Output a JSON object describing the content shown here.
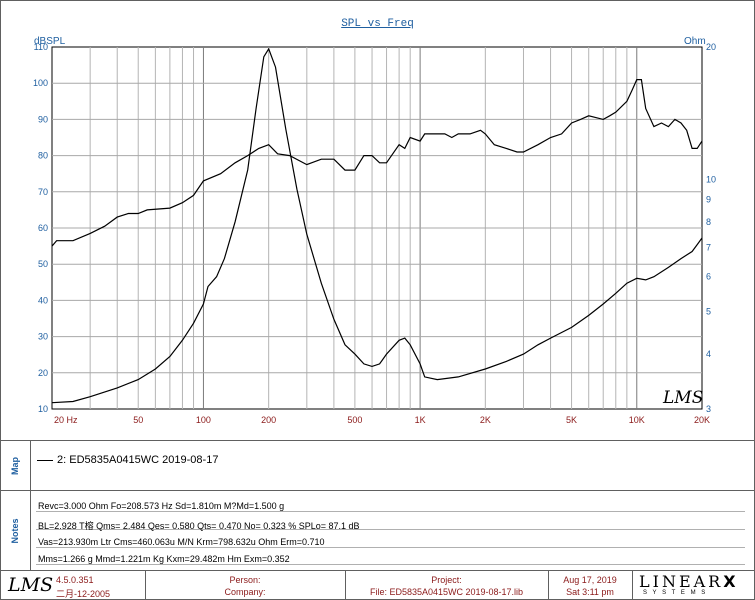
{
  "chart_data": {
    "type": "line",
    "title": "SPL vs Freq",
    "y_left_unit": "dBSPL",
    "y_right_unit": "Ohm",
    "xscale": "log",
    "xlim": [
      20,
      20000
    ],
    "ylim_left": [
      10,
      110
    ],
    "ylim_right": [
      3,
      20
    ],
    "yscale_right": "log",
    "x_tick_labels": [
      "20 Hz",
      "50",
      "100",
      "200",
      "500",
      "1K",
      "2K",
      "5K",
      "10K",
      "20K"
    ],
    "y_left_tick_labels": [
      "10",
      "20",
      "30",
      "40",
      "50",
      "60",
      "70",
      "80",
      "90",
      "100",
      "110"
    ],
    "y_right_tick_labels": [
      "3",
      "4",
      "5",
      "6",
      "7",
      "8",
      "9",
      "10",
      "20"
    ],
    "grid": true,
    "series": [
      {
        "axis": "left",
        "color": "#000000",
        "points": [
          [
            20,
            55
          ],
          [
            21,
            56.5
          ],
          [
            25,
            56.5
          ],
          [
            30,
            58.5
          ],
          [
            35,
            60.5
          ],
          [
            40,
            63
          ],
          [
            45,
            64
          ],
          [
            50,
            64
          ],
          [
            55,
            65
          ],
          [
            70,
            65.5
          ],
          [
            80,
            67
          ],
          [
            90,
            69
          ],
          [
            100,
            73
          ],
          [
            120,
            75
          ],
          [
            140,
            78
          ],
          [
            160,
            80
          ],
          [
            180,
            82
          ],
          [
            200,
            83
          ],
          [
            220,
            80.5
          ],
          [
            250,
            80
          ],
          [
            300,
            77.5
          ],
          [
            350,
            79
          ],
          [
            400,
            79
          ],
          [
            450,
            76
          ],
          [
            500,
            76
          ],
          [
            550,
            80
          ],
          [
            600,
            80
          ],
          [
            650,
            78
          ],
          [
            700,
            78
          ],
          [
            800,
            83
          ],
          [
            850,
            82
          ],
          [
            900,
            85
          ],
          [
            1000,
            84
          ],
          [
            1050,
            86
          ],
          [
            1200,
            86
          ],
          [
            1300,
            86
          ],
          [
            1400,
            85
          ],
          [
            1500,
            86
          ],
          [
            1700,
            86
          ],
          [
            1900,
            87
          ],
          [
            2000,
            86
          ],
          [
            2200,
            83
          ],
          [
            2500,
            82
          ],
          [
            2800,
            81
          ],
          [
            3000,
            81
          ],
          [
            3500,
            83
          ],
          [
            4000,
            85
          ],
          [
            4500,
            86
          ],
          [
            5000,
            89
          ],
          [
            5500,
            90
          ],
          [
            6000,
            91
          ],
          [
            7000,
            90
          ],
          [
            7500,
            91
          ],
          [
            8000,
            92
          ],
          [
            9000,
            95
          ],
          [
            9500,
            98
          ],
          [
            10000,
            101
          ],
          [
            10500,
            101
          ],
          [
            11000,
            93
          ],
          [
            12000,
            88
          ],
          [
            13000,
            89
          ],
          [
            14000,
            88
          ],
          [
            15000,
            90
          ],
          [
            16000,
            89
          ],
          [
            17000,
            87
          ],
          [
            18000,
            82
          ],
          [
            19000,
            82
          ],
          [
            20000,
            84
          ]
        ]
      },
      {
        "axis": "right",
        "color": "#000000",
        "points": [
          [
            20,
            3.1
          ],
          [
            25,
            3.12
          ],
          [
            30,
            3.2
          ],
          [
            40,
            3.35
          ],
          [
            50,
            3.5
          ],
          [
            60,
            3.7
          ],
          [
            70,
            3.95
          ],
          [
            80,
            4.3
          ],
          [
            90,
            4.7
          ],
          [
            100,
            5.2
          ],
          [
            105,
            5.7
          ],
          [
            115,
            6.0
          ],
          [
            125,
            6.6
          ],
          [
            140,
            8.0
          ],
          [
            160,
            10.5
          ],
          [
            175,
            14.5
          ],
          [
            190,
            19.0
          ],
          [
            200,
            19.8
          ],
          [
            215,
            18.0
          ],
          [
            240,
            13.0
          ],
          [
            270,
            9.5
          ],
          [
            300,
            7.5
          ],
          [
            350,
            5.8
          ],
          [
            400,
            4.8
          ],
          [
            450,
            4.2
          ],
          [
            500,
            4.0
          ],
          [
            550,
            3.8
          ],
          [
            600,
            3.75
          ],
          [
            650,
            3.8
          ],
          [
            700,
            4.0
          ],
          [
            800,
            4.3
          ],
          [
            850,
            4.35
          ],
          [
            900,
            4.2
          ],
          [
            1000,
            3.8
          ],
          [
            1050,
            3.55
          ],
          [
            1200,
            3.5
          ],
          [
            1500,
            3.55
          ],
          [
            2000,
            3.7
          ],
          [
            2500,
            3.85
          ],
          [
            3000,
            4.0
          ],
          [
            3500,
            4.2
          ],
          [
            4000,
            4.35
          ],
          [
            5000,
            4.6
          ],
          [
            6000,
            4.9
          ],
          [
            7000,
            5.2
          ],
          [
            8000,
            5.5
          ],
          [
            9000,
            5.8
          ],
          [
            10000,
            5.95
          ],
          [
            11000,
            5.9
          ],
          [
            12000,
            6.0
          ],
          [
            14000,
            6.3
          ],
          [
            16000,
            6.6
          ],
          [
            18000,
            6.85
          ],
          [
            19000,
            7.1
          ],
          [
            20000,
            7.35
          ]
        ]
      }
    ]
  },
  "watermark": "LMS",
  "map": {
    "side_label": "Map",
    "legend_entry": "2: ED5835A0415WC 2019-08-17"
  },
  "notes": {
    "side_label": "Notes",
    "lines": [
      "Revc=3.000 Ohm  Fo=208.573 Hz  Sd=1.810m M?Md=1.500 g",
      "BL=2.928 T榕 Qms= 2.484  Qes= 0.580  Qts= 0.470  No= 0.323 %  SPLo= 87.1 dB",
      "Vas=213.930m Ltr  Cms=460.063u M/N  Krm=798.632u Ohm  Erm=0.710",
      "Mms=1.266 g  Mmd=1.221m Kg  Kxm=29.482m Hm  Exm=0.352"
    ]
  },
  "footer": {
    "logo": "LMS",
    "version": "4.5.0.351",
    "build_date": "二月-12-2005",
    "person_label": "Person:",
    "company_label": "Company:",
    "project_label": "Project:",
    "file_label": "File: ED5835A0415WC 2019-08-17.lib",
    "date": "Aug 17, 2019",
    "time": "Sat  3:11 pm",
    "brand_top": "LINEAR",
    "brand_x": "X",
    "brand_bottom": "S Y S T E M S"
  }
}
